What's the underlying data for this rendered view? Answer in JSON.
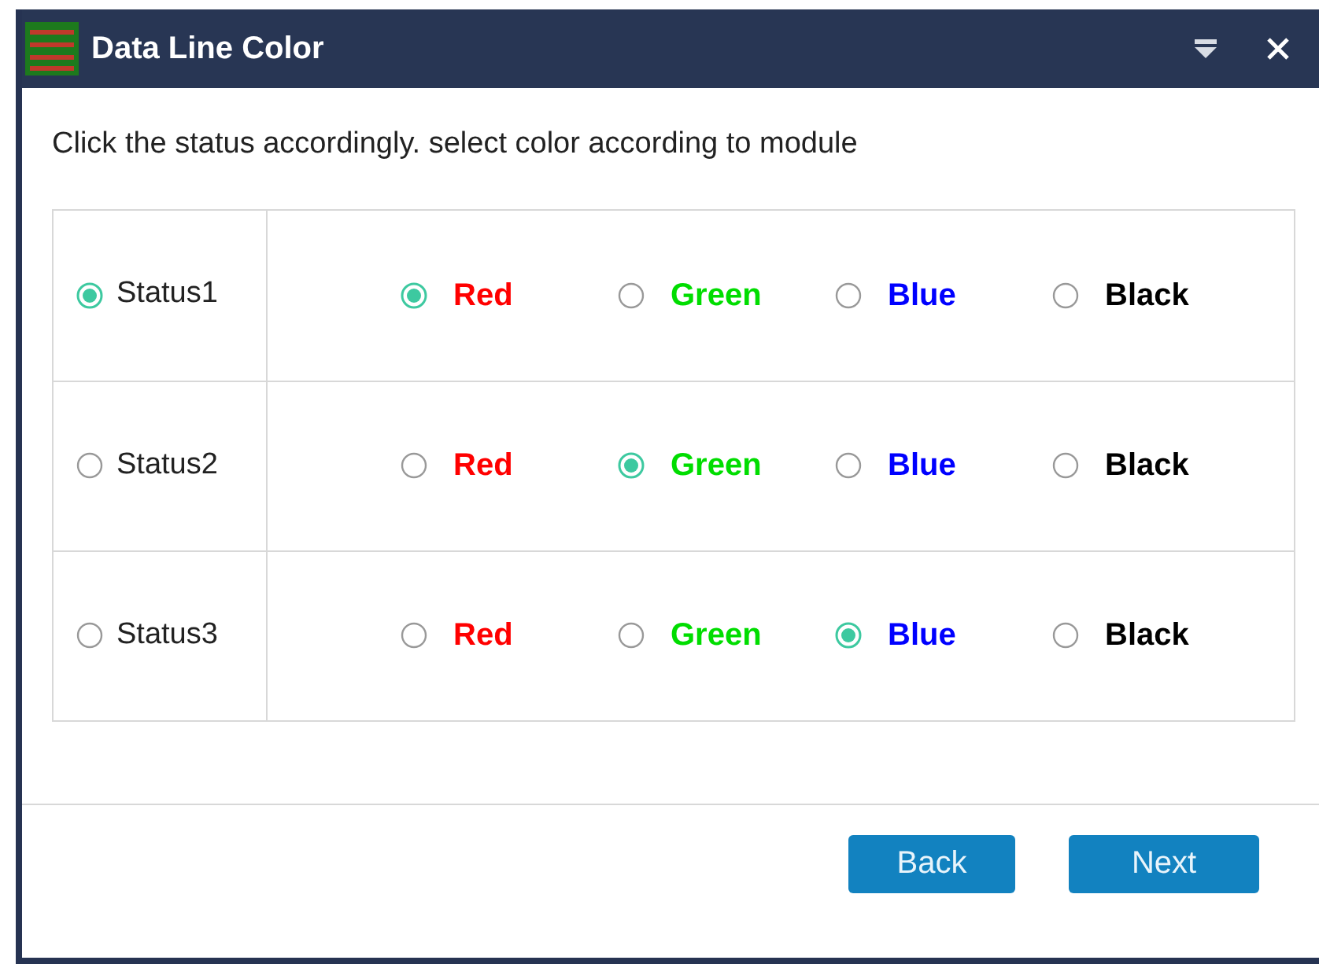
{
  "window": {
    "title": "Data Line Color"
  },
  "instruction": "Click the status accordingly. select color according to module",
  "rows": [
    {
      "status": "Status1",
      "selected": true,
      "colors": [
        {
          "label": "Red",
          "color": "#ff0000",
          "selected": true
        },
        {
          "label": "Green",
          "color": "#00dd00",
          "selected": false
        },
        {
          "label": "Blue",
          "color": "#0000ff",
          "selected": false
        },
        {
          "label": "Black",
          "color": "#000000",
          "selected": false
        }
      ]
    },
    {
      "status": "Status2",
      "selected": false,
      "colors": [
        {
          "label": "Red",
          "color": "#ff0000",
          "selected": false
        },
        {
          "label": "Green",
          "color": "#00dd00",
          "selected": true
        },
        {
          "label": "Blue",
          "color": "#0000ff",
          "selected": false
        },
        {
          "label": "Black",
          "color": "#000000",
          "selected": false
        }
      ]
    },
    {
      "status": "Status3",
      "selected": false,
      "colors": [
        {
          "label": "Red",
          "color": "#ff0000",
          "selected": false
        },
        {
          "label": "Green",
          "color": "#00dd00",
          "selected": false
        },
        {
          "label": "Blue",
          "color": "#0000ff",
          "selected": true
        },
        {
          "label": "Black",
          "color": "#000000",
          "selected": false
        }
      ]
    }
  ],
  "buttons": [
    "Back",
    "Next"
  ]
}
